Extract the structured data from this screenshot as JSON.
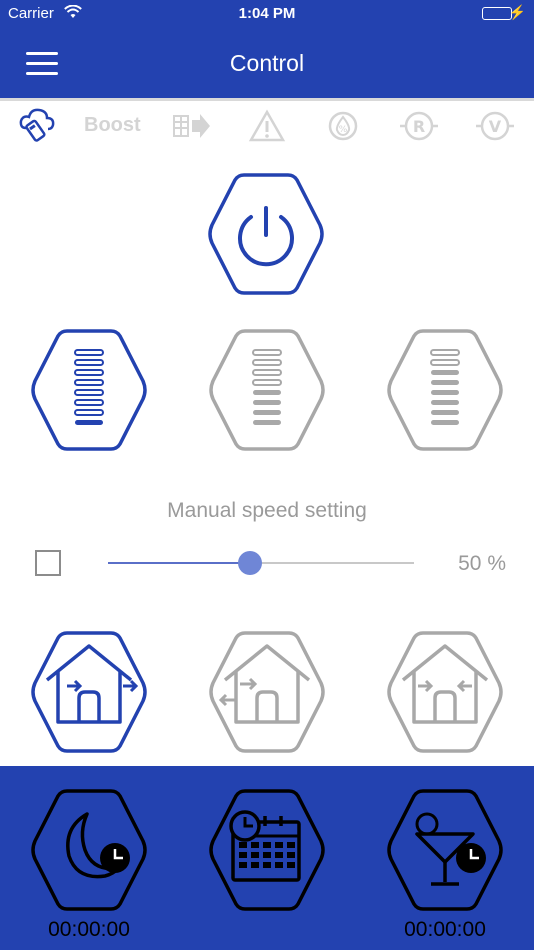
{
  "status_bar": {
    "carrier": "Carrier",
    "time": "1:04 PM"
  },
  "nav": {
    "title": "Control",
    "menu_icon": "hamburger-menu-icon"
  },
  "tabs": [
    {
      "icon": "cloud-phone-icon",
      "active": true
    },
    {
      "label": "Boost",
      "active": false
    },
    {
      "icon": "fan-heat-icon",
      "active": false
    },
    {
      "icon": "warning-icon",
      "active": false
    },
    {
      "icon": "humidity-icon",
      "active": false
    },
    {
      "icon": "r-mode-icon",
      "active": false
    },
    {
      "icon": "v-mode-icon",
      "active": false
    }
  ],
  "power": {
    "icon": "power-icon"
  },
  "speed_modes": [
    {
      "icon": "speed-full-icon",
      "selected": true
    },
    {
      "icon": "speed-medium-icon",
      "selected": false
    },
    {
      "icon": "speed-low-icon",
      "selected": false
    }
  ],
  "manual": {
    "label": "Manual speed setting",
    "checked": false,
    "value_percent": 50,
    "value_text": "50 %"
  },
  "flow_modes": [
    {
      "icon": "house-flow-out-icon",
      "selected": true
    },
    {
      "icon": "house-flow-through-icon",
      "selected": false
    },
    {
      "icon": "house-flow-in-icon",
      "selected": false
    }
  ],
  "timers": [
    {
      "icon": "night-timer-icon",
      "value": "00:00:00"
    },
    {
      "icon": "calendar-timer-icon"
    },
    {
      "icon": "party-timer-icon",
      "value": "00:00:00"
    }
  ],
  "colors": {
    "brand": "#2342b0",
    "active": "#2342b0",
    "inactive": "#a8a8a8",
    "tab_inactive": "#d4d4d4"
  }
}
